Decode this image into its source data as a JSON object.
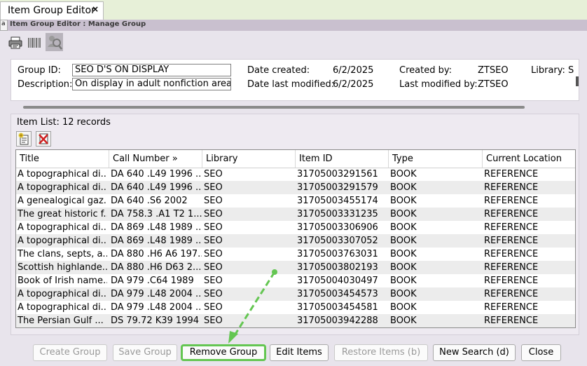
{
  "tab": {
    "title": "Item Group Editor",
    "close": "×"
  },
  "window_title": "Item Group Editor : Manage Group",
  "window_title_prefix": "a",
  "toolbar": {
    "icons": [
      "printer-icon",
      "barcode-icon",
      "search-people-icon"
    ]
  },
  "form": {
    "group_id_label": "Group ID:",
    "group_id_value": "SEO D'S ON DISPLAY",
    "description_label": "Description:",
    "description_value": "On display in adult nonfiction area",
    "date_created_label": "Date created:",
    "date_created_value": "6/2/2025",
    "date_modified_label": "Date last modified:",
    "date_modified_value": "6/2/2025",
    "created_by_label": "Created by:",
    "created_by_value": "ZTSEO",
    "modified_by_label": "Last modified by:",
    "modified_by_value": "ZTSEO",
    "library_label": "Library: S"
  },
  "item_list": {
    "label": "Item List: 12 records",
    "columns": [
      "Title",
      "Call Number »",
      "Library",
      "Item ID",
      "Type",
      "Current Location"
    ],
    "rows": [
      [
        "A topographical di...",
        "DA 640 .L49 1996 ...",
        "SEO",
        "31705003291561",
        "BOOK",
        "REFERENCE"
      ],
      [
        "A topographical di...",
        "DA 640 .L49 1996 ...",
        "SEO",
        "31705003291579",
        "BOOK",
        "REFERENCE"
      ],
      [
        "A genealogical gaz...",
        "DA 640 .S6 2002",
        "SEO",
        "31705003455174",
        "BOOK",
        "REFERENCE"
      ],
      [
        "The great historic f...",
        "DA 758.3 .A1 T2 1...",
        "SEO",
        "31705003331235",
        "BOOK",
        "REFERENCE"
      ],
      [
        "A topographical di...",
        "DA 869 .L48 1989 ...",
        "SEO",
        "31705003306906",
        "BOOK",
        "REFERENCE"
      ],
      [
        "A topographical di...",
        "DA 869 .L48 1989 ...",
        "SEO",
        "31705003307052",
        "BOOK",
        "REFERENCE"
      ],
      [
        "The clans, septs, a...",
        "DA 880 .H6 A6 197...",
        "SEO",
        "31705003763031",
        "BOOK",
        "REFERENCE"
      ],
      [
        "Scottish highlande...",
        "DA 880 .H6 D63 2...",
        "SEO",
        "31705003802193",
        "BOOK",
        "REFERENCE"
      ],
      [
        "Book of Irish name...",
        "DA 979 .C64 1989",
        "SEO",
        "31705004030497",
        "BOOK",
        "REFERENCE"
      ],
      [
        "A topographical di...",
        "DA 979 .L48 2004 ...",
        "SEO",
        "31705003454573",
        "BOOK",
        "REFERENCE"
      ],
      [
        "A topographical di...",
        "DA 979 .L48 2004 ...",
        "SEO",
        "31705003454581",
        "BOOK",
        "REFERENCE"
      ],
      [
        "The Persian Gulf ...",
        "DS 79.72 K39 1994",
        "SEO",
        "31705003942288",
        "BOOK",
        "REFERENCE"
      ]
    ]
  },
  "buttons": {
    "create_group": "Create Group",
    "save_group": "Save Group",
    "remove_group": "Remove Group",
    "edit_items": "Edit Items",
    "restore_items": "Restore Items (b)",
    "new_search": "New Search (d)",
    "close": "Close"
  },
  "colors": {
    "highlight": "#64c652",
    "tab_bar": "#e7f0d8",
    "title_bar": "#c9c0cf"
  }
}
